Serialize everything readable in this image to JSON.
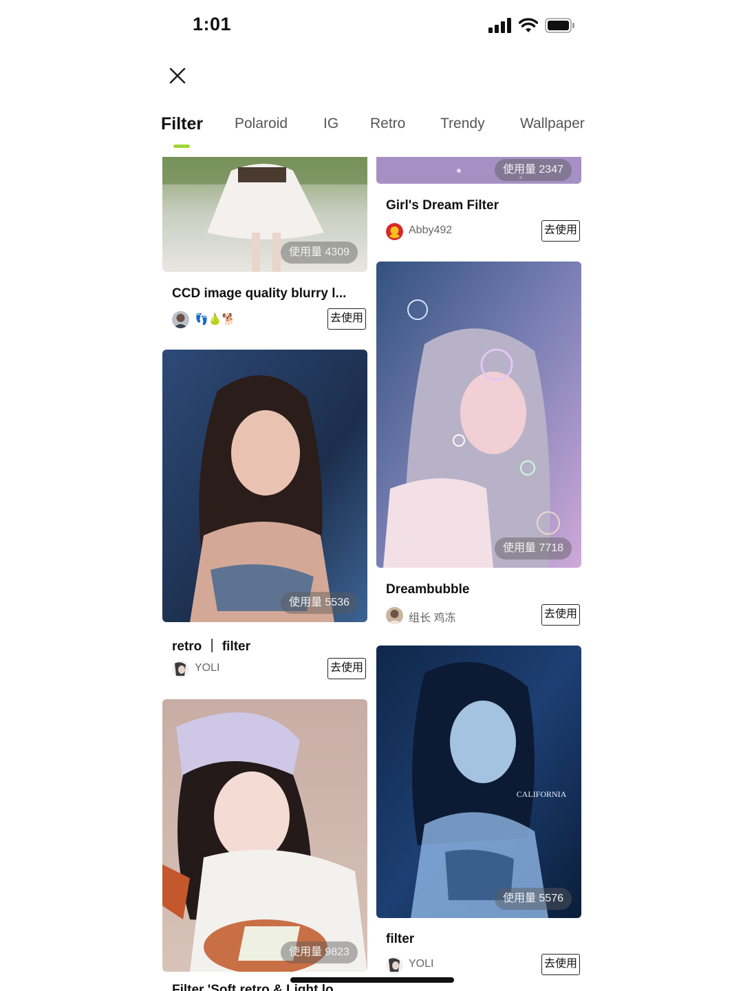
{
  "status_bar": {
    "time": "1:01"
  },
  "tabs": [
    {
      "label": "Filter",
      "active": true
    },
    {
      "label": "Polaroid",
      "active": false
    },
    {
      "label": "IG",
      "active": false
    },
    {
      "label": "Retro",
      "active": false
    },
    {
      "label": "Trendy",
      "active": false
    },
    {
      "label": "Wallpaper",
      "active": false
    }
  ],
  "accent_color": "#9ed832",
  "use_label": "去使用",
  "cards": [
    {
      "title": "CCD image quality blurry l...",
      "author": "👣🍐🐕",
      "usage": "使用量 4309"
    },
    {
      "title": "Girl's Dream Filter",
      "author": "Abby492",
      "usage": "使用量 2347"
    },
    {
      "title": "retro ｜ filter",
      "author": "YOLI",
      "usage": "使用量 5536"
    },
    {
      "title": "Dreambubble",
      "author": "组长 鸡冻",
      "usage": "使用量 7718"
    },
    {
      "title": "Filter 'Soft retro & Light lo",
      "author": "",
      "usage": "使用量 9823"
    },
    {
      "title": "filter",
      "author": "YOLI",
      "usage": "使用量 5576"
    }
  ],
  "overlay_text": {
    "california": "CALIFORNIA"
  }
}
